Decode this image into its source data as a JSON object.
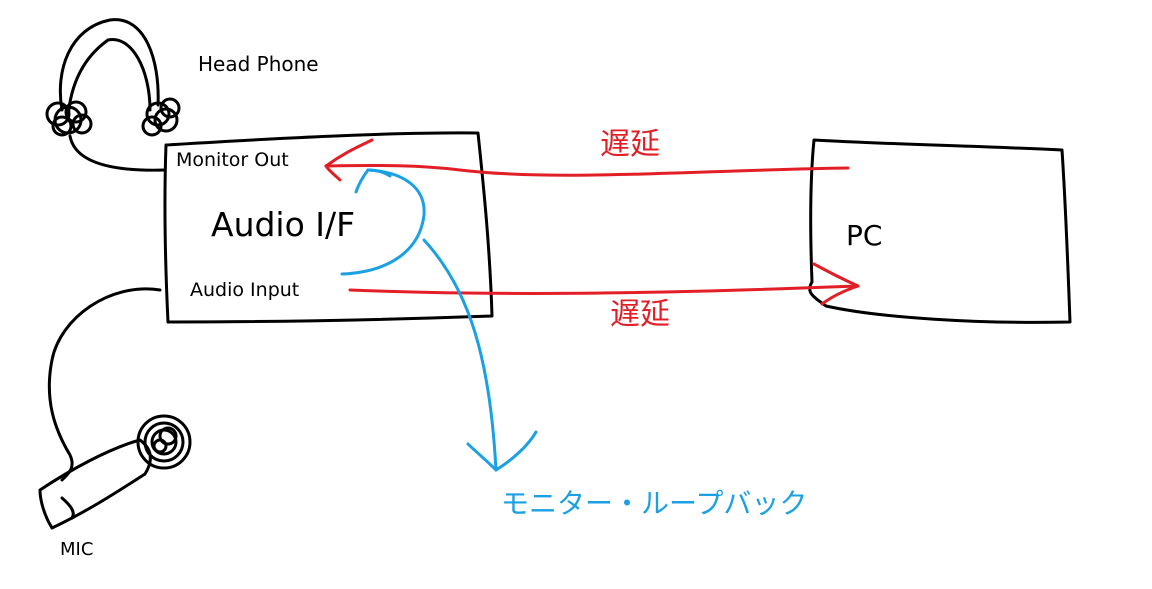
{
  "colors": {
    "ink": "#000000",
    "delay": "#e21f26",
    "loopback": "#1aa0e3"
  },
  "labels": {
    "headphone": "Head Phone",
    "monitor_out": "Monitor Out",
    "audio_if": "Audio I/F",
    "audio_input": "Audio Input",
    "pc": "PC",
    "mic": "MIC",
    "delay_top": "遅延",
    "delay_bottom": "遅延",
    "loopback": "モニター・ループバック"
  },
  "icons": {
    "headphone": "headphone-icon",
    "microphone": "microphone-icon"
  }
}
